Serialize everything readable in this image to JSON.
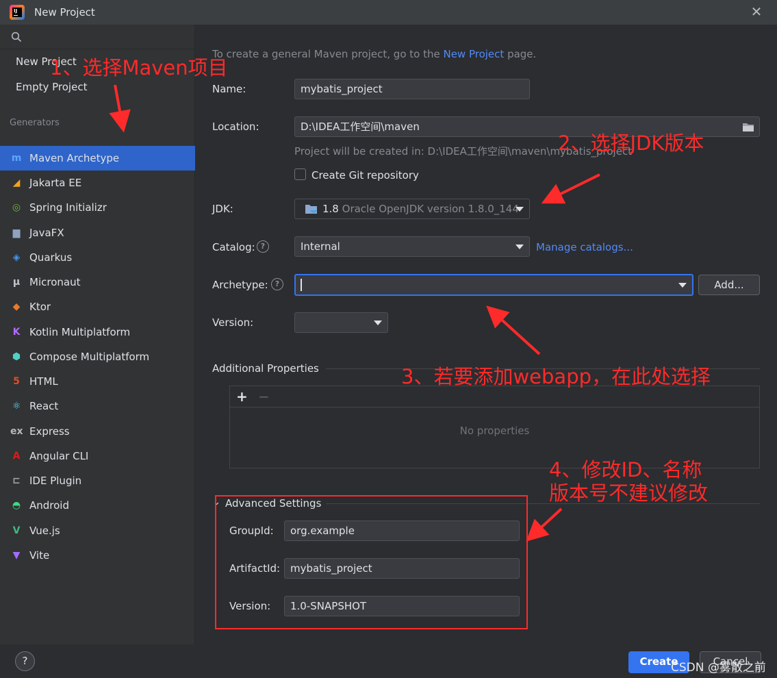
{
  "window": {
    "title": "New Project",
    "close_glyph": "✕"
  },
  "sidebar": {
    "search_placeholder": "",
    "top_items": [
      {
        "label": "New Project"
      },
      {
        "label": "Empty Project"
      }
    ],
    "generators_label": "Generators",
    "generators": [
      {
        "label": "Maven Archetype",
        "icon": "maven-icon",
        "glyph": "m",
        "color": "#5ea6ff",
        "selected": true
      },
      {
        "label": "Jakarta EE",
        "icon": "jakarta-icon",
        "glyph": "◢",
        "color": "#f2a31a"
      },
      {
        "label": "Spring Initializr",
        "icon": "spring-icon",
        "glyph": "◎",
        "color": "#6db33f"
      },
      {
        "label": "JavaFX",
        "icon": "javafx-icon",
        "glyph": "▆",
        "color": "#8fa3bf"
      },
      {
        "label": "Quarkus",
        "icon": "quarkus-icon",
        "glyph": "◈",
        "color": "#4695eb"
      },
      {
        "label": "Micronaut",
        "icon": "micronaut-icon",
        "glyph": "μ",
        "color": "#c0c4cc"
      },
      {
        "label": "Ktor",
        "icon": "ktor-icon",
        "glyph": "◆",
        "color": "#e57b2e"
      },
      {
        "label": "Kotlin Multiplatform",
        "icon": "kotlin-icon",
        "glyph": "K",
        "color": "#b26cf7"
      },
      {
        "label": "Compose Multiplatform",
        "icon": "compose-icon",
        "glyph": "⬢",
        "color": "#4fd1c5"
      },
      {
        "label": "HTML",
        "icon": "html-icon",
        "glyph": "5",
        "color": "#e44d26"
      },
      {
        "label": "React",
        "icon": "react-icon",
        "glyph": "⚛",
        "color": "#61dafb"
      },
      {
        "label": "Express",
        "icon": "express-icon",
        "glyph": "ex",
        "color": "#b4b8bf"
      },
      {
        "label": "Angular CLI",
        "icon": "angular-icon",
        "glyph": "A",
        "color": "#dd1b16"
      },
      {
        "label": "IDE Plugin",
        "icon": "plugin-icon",
        "glyph": "⊏",
        "color": "#9da0a8"
      },
      {
        "label": "Android",
        "icon": "android-icon",
        "glyph": "◓",
        "color": "#3ddc84"
      },
      {
        "label": "Vue.js",
        "icon": "vue-icon",
        "glyph": "V",
        "color": "#41b883"
      },
      {
        "label": "Vite",
        "icon": "vite-icon",
        "glyph": "▼",
        "color": "#a46bff"
      }
    ]
  },
  "form": {
    "intro_prefix": "To create a general Maven project, go to the ",
    "intro_link": "New Project",
    "intro_suffix": " page.",
    "name_label": "Name:",
    "name_value": "mybatis_project",
    "location_label": "Location:",
    "location_value": "D:\\IDEA工作空间\\maven",
    "location_hint": "Project will be created in: D:\\IDEA工作空间\\maven\\mybatis_project",
    "git_label": "Create Git repository",
    "jdk_label": "JDK:",
    "jdk_version": "1.8",
    "jdk_desc": "Oracle OpenJDK version 1.8.0_144",
    "catalog_label": "Catalog:",
    "catalog_value": "Internal",
    "manage_catalogs": "Manage catalogs...",
    "archetype_label": "Archetype:",
    "archetype_value": "",
    "add_button": "Add...",
    "version_label": "Version:",
    "version_value": "",
    "additional_props_label": "Additional Properties",
    "add_prop_glyph": "+",
    "remove_prop_glyph": "−",
    "no_properties": "No properties",
    "advanced_label": "Advanced Settings",
    "groupid_label": "GroupId:",
    "groupid_value": "org.example",
    "artifactid_label": "ArtifactId:",
    "artifactid_value": "mybatis_project",
    "adv_version_label": "Version:",
    "adv_version_value": "1.0-SNAPSHOT"
  },
  "footer": {
    "help": "?",
    "create": "Create",
    "cancel": "Cancel",
    "watermark": "CSDN @雾散之前"
  },
  "annotations": {
    "a1": "1、选择Maven项目",
    "a2": "2、选择JDK版本",
    "a3": "3、若要添加webapp，在此处选择",
    "a4_line1": "4、修改ID、名称",
    "a4_line2": "版本号不建议修改"
  },
  "colors": {
    "accent": "#2f65ca",
    "link": "#548af7",
    "annotation": "#ff2a2a",
    "primary_button": "#3574f0"
  }
}
